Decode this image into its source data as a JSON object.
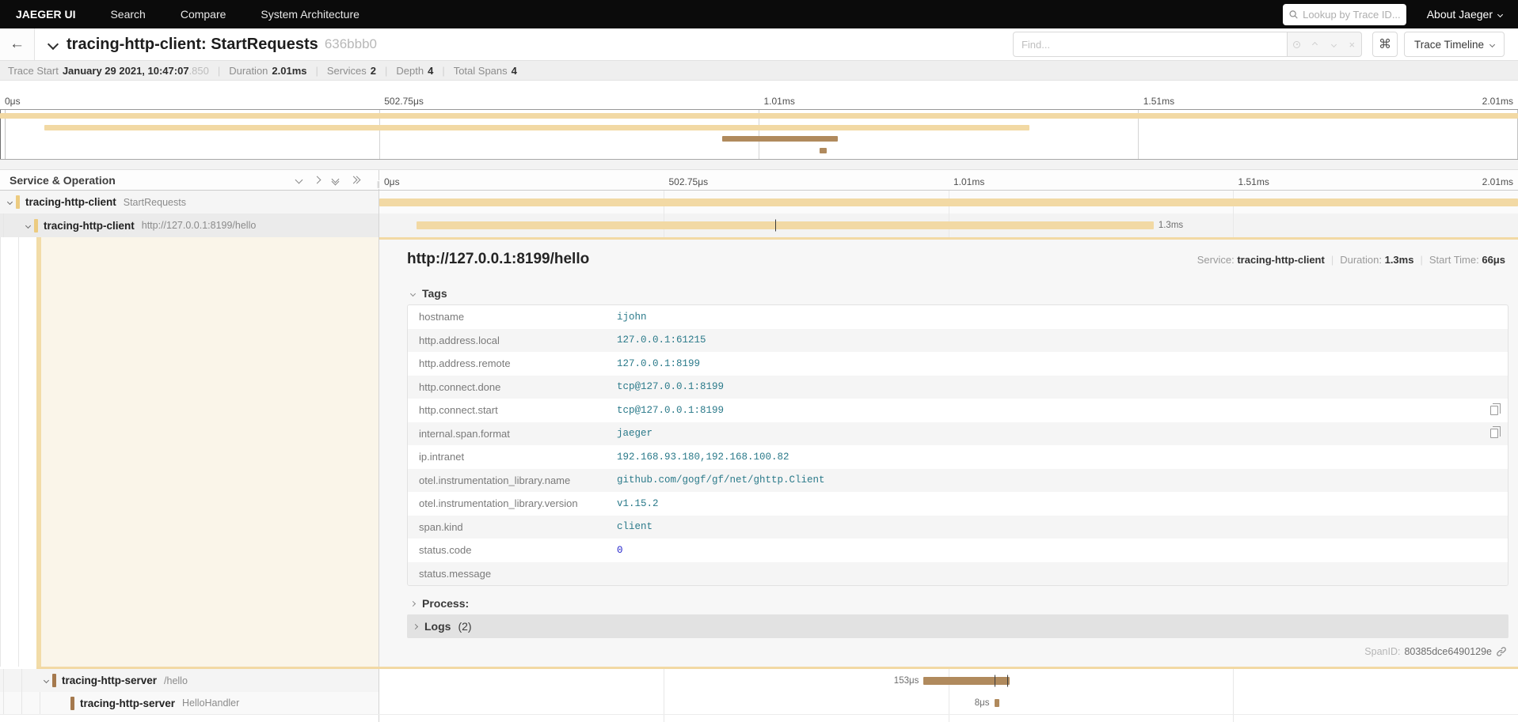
{
  "nav": {
    "brand": "JAEGER UI",
    "links": [
      "Search",
      "Compare",
      "System Architecture"
    ],
    "lookup_placeholder": "Lookup by Trace ID...",
    "about_label": "About Jaeger"
  },
  "header": {
    "title": "tracing-http-client: StartRequests",
    "trace_id": "636bbb0",
    "find_placeholder": "Find...",
    "shortcut_key": "⌘",
    "view_label": "Trace Timeline"
  },
  "summary": {
    "items": [
      {
        "label": "Trace Start",
        "value": "January 29 2021, 10:47:07",
        "suffix": ".850"
      },
      {
        "label": "Duration",
        "value": "2.01ms"
      },
      {
        "label": "Services",
        "value": "2"
      },
      {
        "label": "Depth",
        "value": "4"
      },
      {
        "label": "Total Spans",
        "value": "4"
      }
    ]
  },
  "ticks": [
    "0μs",
    "502.75μs",
    "1.01ms",
    "1.51ms",
    "2.01ms"
  ],
  "minimap_bars": [
    {
      "left_pct": 0,
      "width_pct": 100,
      "color": "#f2d9a4"
    },
    {
      "left_pct": 2.9,
      "width_pct": 64.9,
      "color": "#f2d9a4"
    },
    {
      "left_pct": 47.6,
      "width_pct": 7.6,
      "color": "#b08a5d"
    },
    {
      "left_pct": 54.0,
      "width_pct": 0.45,
      "color": "#b08a5d"
    }
  ],
  "span_table": {
    "left_header": "Service & Operation",
    "rows": [
      {
        "service": "tracing-http-client",
        "operation": "StartRequests",
        "bar": {
          "left_pct": 0,
          "width_pct": 100,
          "color": "#f2d9a4",
          "ticks": [],
          "label": "",
          "label_side": "none"
        }
      },
      {
        "service": "tracing-http-client",
        "operation": "http://127.0.0.1:8199/hello",
        "bar": {
          "left_pct": 3.3,
          "width_pct": 64.7,
          "color": "#f2d9a4",
          "ticks": [
            34.8
          ],
          "label": "1.3ms",
          "label_side": "right"
        }
      },
      {
        "service": "tracing-http-server",
        "operation": "/hello",
        "bar": {
          "left_pct": 47.8,
          "width_pct": 7.55,
          "color": "#b08a5d",
          "ticks": [
            54.05,
            55.15
          ],
          "label": "153μs",
          "label_side": "left"
        }
      },
      {
        "service": "tracing-http-server",
        "operation": "HelloHandler",
        "bar": {
          "left_pct": 54.0,
          "width_pct": 0.42,
          "color": "#b08a5d",
          "ticks": [],
          "label": "8μs",
          "label_side": "left"
        }
      }
    ]
  },
  "detail": {
    "title": "http://127.0.0.1:8199/hello",
    "service_label": "Service:",
    "service": "tracing-http-client",
    "duration_label": "Duration:",
    "duration": "1.3ms",
    "start_label": "Start Time:",
    "start": "66μs",
    "tags_label": "Tags",
    "tags": [
      {
        "key": "hostname",
        "value": "ijohn"
      },
      {
        "key": "http.address.local",
        "value": "127.0.0.1:61215"
      },
      {
        "key": "http.address.remote",
        "value": "127.0.0.1:8199"
      },
      {
        "key": "http.connect.done",
        "value": "tcp@127.0.0.1:8199"
      },
      {
        "key": "http.connect.start",
        "value": "tcp@127.0.0.1:8199",
        "copy": true
      },
      {
        "key": "internal.span.format",
        "value": "jaeger",
        "copy": true
      },
      {
        "key": "ip.intranet",
        "value": "192.168.93.180,192.168.100.82"
      },
      {
        "key": "otel.instrumentation_library.name",
        "value": "github.com/gogf/gf/net/ghttp.Client"
      },
      {
        "key": "otel.instrumentation_library.version",
        "value": "v1.15.2"
      },
      {
        "key": "span.kind",
        "value": "client"
      },
      {
        "key": "status.code",
        "value": "0",
        "numeric": true
      },
      {
        "key": "status.message",
        "value": ""
      }
    ],
    "process_label": "Process:",
    "logs_label": "Logs",
    "logs_count": "(2)",
    "spanid_label": "SpanID:",
    "spanid": "80385dce6490129e"
  },
  "colors": {
    "span_light": "#f2d9a4",
    "span_dark": "#b08a5d",
    "accent_client": "#eccb80",
    "accent_server": "#a5794d",
    "detail_cream": "#faf5e9"
  }
}
